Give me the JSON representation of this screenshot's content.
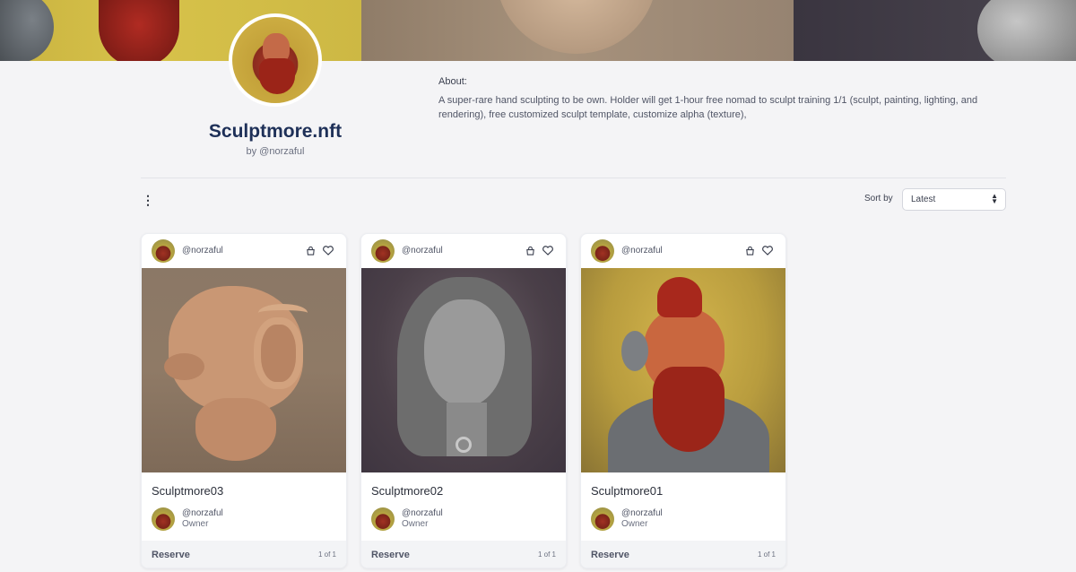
{
  "collection": {
    "title": "Sculptmore.nft",
    "by": "by @norzaful",
    "about_label": "About:",
    "about_text": "A super-rare hand sculpting to be own. Holder will get 1-hour free nomad to sculpt training 1/1 (sculpt, painting, lighting, and rendering), free customized sculpt template, customize alpha (texture),"
  },
  "toolbar": {
    "menu_icon": "kebab-menu-icon",
    "sort_label": "Sort by",
    "sort_value": "Latest"
  },
  "cards": [
    {
      "handle": "@norzaful",
      "title": "Sculptmore03",
      "owner_name": "@norzaful",
      "owner_role": "Owner",
      "action": "Reserve",
      "edition": "1 of 1"
    },
    {
      "handle": "@norzaful",
      "title": "Sculptmore02",
      "owner_name": "@norzaful",
      "owner_role": "Owner",
      "action": "Reserve",
      "edition": "1 of 1"
    },
    {
      "handle": "@norzaful",
      "title": "Sculptmore01",
      "owner_name": "@norzaful",
      "owner_role": "Owner",
      "action": "Reserve",
      "edition": "1 of 1"
    }
  ],
  "colors": {
    "title": "#1e3058",
    "background": "#f4f4f6",
    "card": "#ffffff"
  }
}
